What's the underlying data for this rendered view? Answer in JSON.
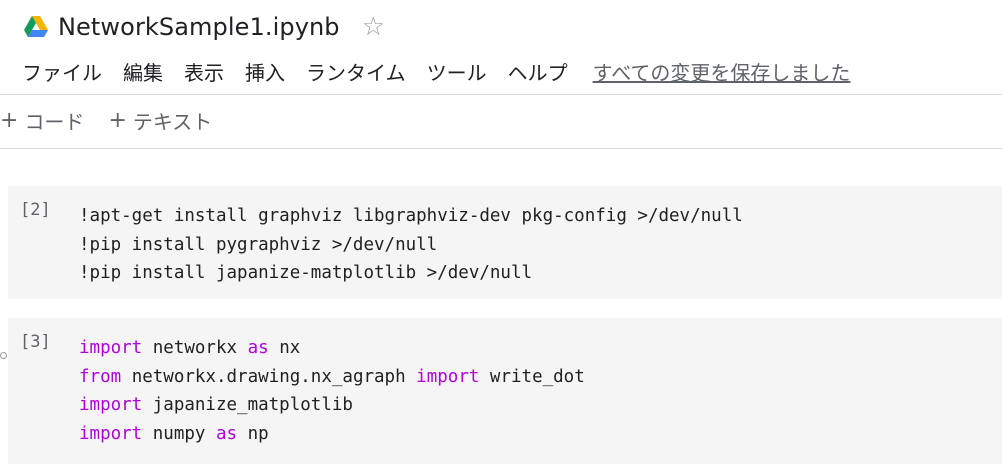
{
  "header": {
    "title": "NetworkSample1.ipynb",
    "star_icon": "star-outline-icon",
    "save_status": "すべての変更を保存しました"
  },
  "menu": {
    "items": [
      {
        "label": "ファイル"
      },
      {
        "label": "編集"
      },
      {
        "label": "表示"
      },
      {
        "label": "挿入"
      },
      {
        "label": "ランタイム"
      },
      {
        "label": "ツール"
      },
      {
        "label": "ヘルプ"
      }
    ]
  },
  "toolbar": {
    "add_code": {
      "plus": "+",
      "label": "コード"
    },
    "add_text": {
      "plus": "+",
      "label": "テキスト"
    }
  },
  "cells": [
    {
      "exec_count": "[2]",
      "lines": [
        "!apt-get install graphviz libgraphviz-dev pkg-config >/dev/null",
        "!pip install pygraphviz >/dev/null",
        "!pip install japanize-matplotlib >/dev/null"
      ]
    },
    {
      "exec_count": "[3]",
      "lines": [
        {
          "kw1": "import",
          "t1": " networkx ",
          "kw2": "as",
          "t2": " nx"
        },
        {
          "kw1": "from",
          "t1": " networkx.drawing.nx_agraph ",
          "kw2": "import",
          "t2": " write_dot"
        },
        {
          "kw1": "import",
          "t1": " japanize_matplotlib",
          "kw2": "",
          "t2": ""
        },
        {
          "kw1": "import",
          "t1": " numpy ",
          "kw2": "as",
          "t2": " np"
        }
      ]
    }
  ],
  "colors": {
    "keyword": "#af00db",
    "cell_bg": "#f5f5f5",
    "drive_green": "#0f9d58",
    "drive_yellow": "#f4b400",
    "drive_blue": "#4285f4"
  }
}
